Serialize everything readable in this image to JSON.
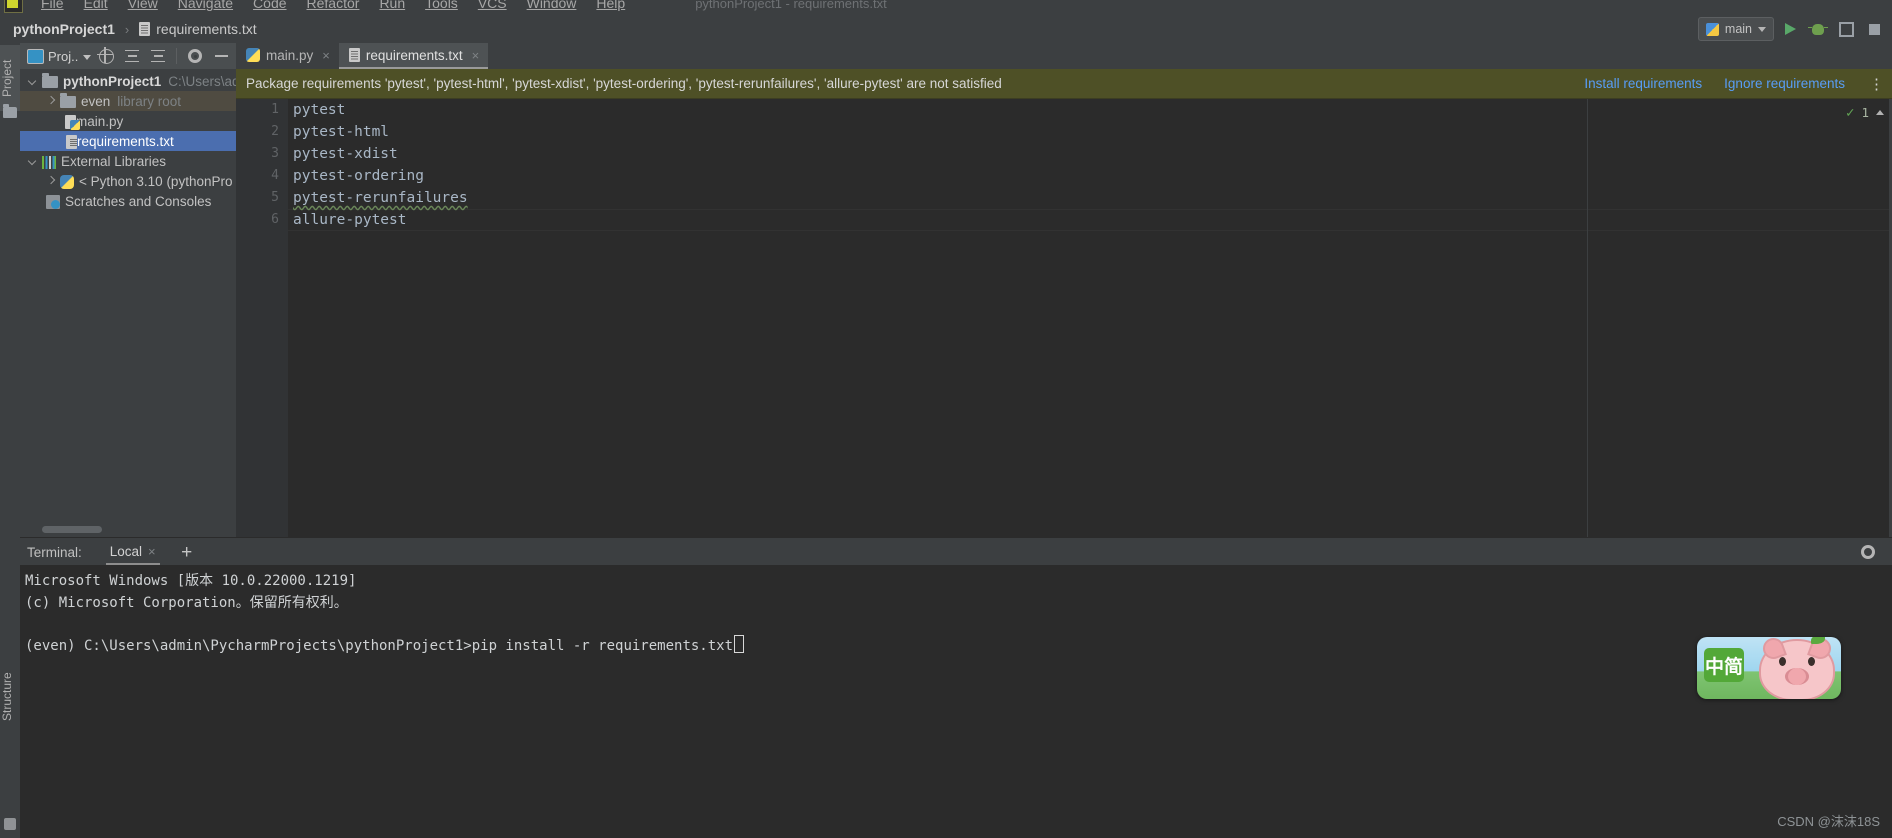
{
  "window": {
    "title": "pythonProject1 - requirements.txt"
  },
  "menubar": {
    "items": [
      {
        "label": "File"
      },
      {
        "label": "Edit"
      },
      {
        "label": "View"
      },
      {
        "label": "Navigate"
      },
      {
        "label": "Code"
      },
      {
        "label": "Refactor"
      },
      {
        "label": "Run"
      },
      {
        "label": "Tools"
      },
      {
        "label": "VCS"
      },
      {
        "label": "Window"
      },
      {
        "label": "Help"
      }
    ]
  },
  "navbar": {
    "breadcrumb": {
      "project": "pythonProject1",
      "separator": "›",
      "file": "requirements.txt"
    },
    "run_config": {
      "label": "main",
      "icon": "python-config-icon",
      "caret": "chevron-down-icon"
    },
    "buttons": [
      {
        "name": "run-button",
        "icon": "play-icon"
      },
      {
        "name": "debug-button",
        "icon": "bug-icon"
      },
      {
        "name": "coverage-button",
        "icon": "run-with-coverage-icon"
      },
      {
        "name": "stop-button",
        "icon": "stop-icon"
      }
    ]
  },
  "left_strip": {
    "project_tab": "Project",
    "structure_tab": "Structure"
  },
  "project_panel": {
    "header": {
      "title": "Proj..",
      "icons": [
        "project-view-icon",
        "chevron-down-icon",
        "locate-icon",
        "expand-all-icon",
        "collapse-all-icon",
        "settings-icon",
        "hide-icon"
      ]
    },
    "tree": [
      {
        "label": "pythonProject1",
        "sublabel": "C:\\Users\\ad",
        "icon": "folder-icon",
        "arrow": "down",
        "indent": 0,
        "bold": true,
        "state": "normal"
      },
      {
        "label": "even",
        "sublabel": "library root",
        "icon": "folder-icon",
        "arrow": "right",
        "indent": 1,
        "bold": false,
        "state": "highlight"
      },
      {
        "label": "main.py",
        "sublabel": "",
        "icon": "python-file-icon",
        "arrow": "none",
        "indent": 2,
        "bold": false,
        "state": "normal"
      },
      {
        "label": "requirements.txt",
        "sublabel": "",
        "icon": "text-file-icon",
        "arrow": "none",
        "indent": 2,
        "bold": false,
        "state": "selected"
      },
      {
        "label": "External Libraries",
        "sublabel": "",
        "icon": "library-icon",
        "arrow": "down",
        "indent": 0,
        "bold": false,
        "state": "normal"
      },
      {
        "label": "< Python 3.10 (pythonPro",
        "sublabel": "",
        "icon": "python-sdk-icon",
        "arrow": "right",
        "indent": 1,
        "bold": false,
        "state": "normal"
      },
      {
        "label": "Scratches and Consoles",
        "sublabel": "",
        "icon": "scratches-icon",
        "arrow": "none",
        "indent": 0,
        "bold": false,
        "state": "normal"
      }
    ]
  },
  "tabs": [
    {
      "label": "main.py",
      "icon": "python-file-icon",
      "close": "×",
      "active": false
    },
    {
      "label": "requirements.txt",
      "icon": "text-file-icon",
      "close": "×",
      "active": true
    }
  ],
  "banner": {
    "message": "Package requirements 'pytest', 'pytest-html', 'pytest-xdist', 'pytest-ordering', 'pytest-rerunfailures', 'allure-pytest' are not satisfied",
    "install_link": "Install requirements",
    "ignore_link": "Ignore requirements",
    "more": "⋮",
    "background": "#4e5026"
  },
  "editor": {
    "line_numbers": [
      "1",
      "2",
      "3",
      "4",
      "5",
      "6"
    ],
    "lines": [
      {
        "text": "pytest",
        "squiggle": false
      },
      {
        "text": "pytest-html",
        "squiggle": false
      },
      {
        "text": "pytest-xdist",
        "squiggle": false
      },
      {
        "text": "pytest-ordering",
        "squiggle": false
      },
      {
        "text": "pytest-rerunfailures",
        "squiggle": true
      },
      {
        "text": "allure-pytest",
        "squiggle": false
      }
    ],
    "inspection": {
      "icon": "inspection-check-icon",
      "count": "1",
      "caret": "chevron-up-icon"
    }
  },
  "terminal": {
    "title": "Terminal:",
    "tab_label": "Local",
    "tab_close": "×",
    "add_tab": "+",
    "settings_icon": "gear-icon",
    "lines": [
      "Microsoft Windows [版本 10.0.22000.1219]",
      "(c) Microsoft Corporation。保留所有权利。",
      "",
      "(even) C:\\Users\\admin\\PycharmProjects\\pythonProject1>pip install -r requirements.txt"
    ]
  },
  "mascot": {
    "badge_text": "中简",
    "name": "ime-pig-mascot"
  },
  "watermark": "CSDN @沫沫18S",
  "colors": {
    "background": "#3c3f41",
    "editor_background": "#2b2b2b",
    "selection": "#4b6eaf",
    "banner": "#4e5026",
    "link": "#589df6",
    "squiggle": "#6a8759"
  }
}
